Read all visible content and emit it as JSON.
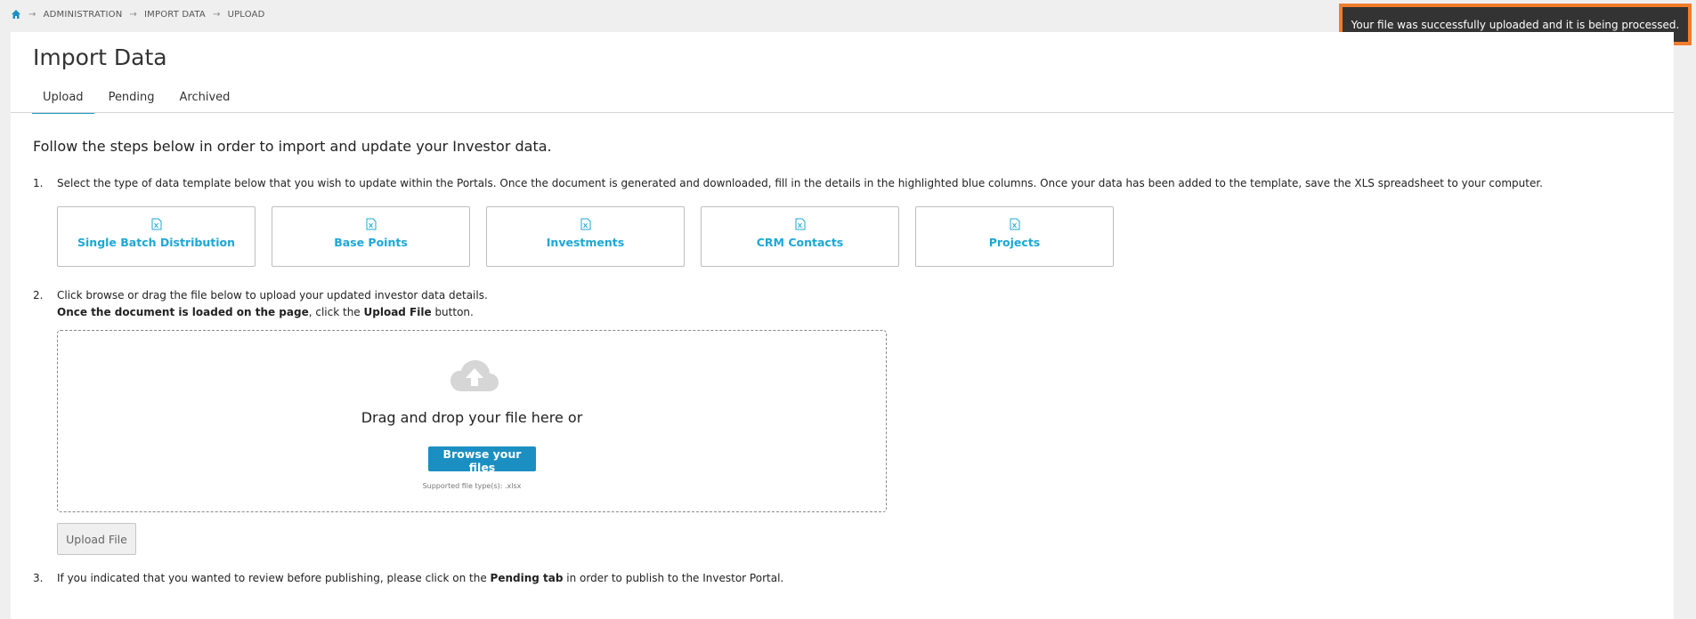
{
  "breadcrumb": {
    "items": [
      "ADMINISTRATION",
      "IMPORT DATA",
      "UPLOAD"
    ]
  },
  "toast": {
    "message": "Your file was successfully uploaded and it is being processed."
  },
  "page": {
    "title": "Import Data"
  },
  "tabs": [
    {
      "label": "Upload",
      "active": true
    },
    {
      "label": "Pending",
      "active": false
    },
    {
      "label": "Archived",
      "active": false
    }
  ],
  "intro": "Follow the steps below in order to import and update your Investor data.",
  "step1": {
    "number": "1.",
    "text": "Select the type of data template below that you wish to update within the Portals. Once the document is generated and downloaded, fill in the details in the highlighted blue columns. Once your data has been added to the template, save the XLS spreadsheet to your computer."
  },
  "templates": [
    {
      "label": "Single Batch Distribution"
    },
    {
      "label": "Base Points"
    },
    {
      "label": "Investments"
    },
    {
      "label": "CRM Contacts"
    },
    {
      "label": "Projects"
    }
  ],
  "step2": {
    "number": "2.",
    "line1": "Click browse or drag the file below to upload your updated investor data details.",
    "line2_bold": "Once the document is loaded on the page",
    "line2_mid": ", click the ",
    "line2_bold2": "Upload File",
    "line2_end": " button."
  },
  "dropzone": {
    "drag_text": "Drag and drop your file here or",
    "browse_label": "Browse your files",
    "supported": "Supported file type(s): .xlsx"
  },
  "upload_button": {
    "label": "Upload File"
  },
  "step3": {
    "number": "3.",
    "pre": "If you indicated that you wanted to review before publishing, please click on the ",
    "bold": "Pending tab",
    "post": " in order to publish to the Investor Portal."
  },
  "colors": {
    "accent": "#1b9bc8",
    "button": "#1b8fc2",
    "toast_border": "#f27c2a",
    "toast_bg": "#333333"
  }
}
